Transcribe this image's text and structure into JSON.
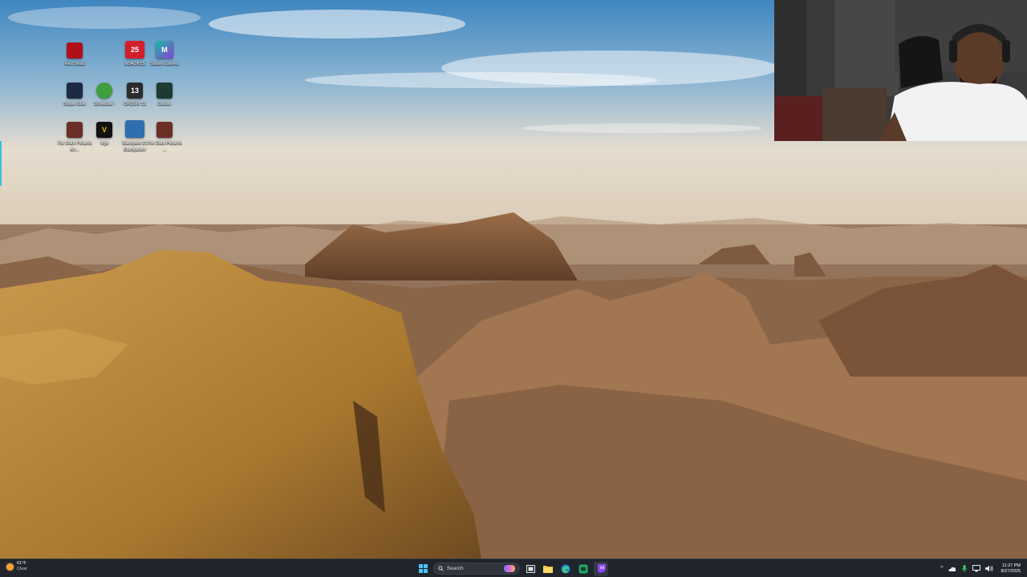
{
  "desktop": {
    "icons": [
      {
        "label": "Red Dead",
        "color": "#b0101a",
        "glyph": "",
        "lines": 1
      },
      {
        "label": "NBA 2K25",
        "color": "#d21f2a",
        "glyph": "25",
        "lines": 1
      },
      {
        "label": "Steam Games",
        "color": "#14bfa1",
        "glyph": "M",
        "lines": 1
      },
      {
        "label": "Sniper Elite",
        "color": "#1e2a44",
        "glyph": "",
        "lines": 1
      },
      {
        "label": "Schedule I",
        "color": "#3d9f3d",
        "glyph": "",
        "lines": 1
      },
      {
        "label": "ORDER 13",
        "color": "#2b2b2b",
        "glyph": "13",
        "lines": 1
      },
      {
        "label": "Gruber",
        "color": "#1f3b31",
        "glyph": "",
        "lines": 1
      },
      {
        "label": "The Dark Pictures An...",
        "color": "#6b2f26",
        "glyph": "",
        "lines": 2
      },
      {
        "label": "Vigil",
        "color": "#111111",
        "glyph": "V",
        "lines": 1
      },
      {
        "label": "Blackjack 21 Blackjacker",
        "color": "#2e6fb0",
        "glyph": "",
        "lines": 2
      },
      {
        "label": "The Dark Pictures ...",
        "color": "#6b2f26",
        "glyph": "",
        "lines": 2
      }
    ]
  },
  "taskbar": {
    "weather": {
      "temp": "61°F",
      "condition": "Clear",
      "icon": "sun-icon"
    },
    "search": {
      "placeholder": "Search"
    },
    "apps": [
      {
        "name": "start-button",
        "icon": "windows-logo-icon"
      },
      {
        "name": "task-view-button",
        "icon": "task-view-icon"
      },
      {
        "name": "file-explorer-button",
        "icon": "folder-icon"
      },
      {
        "name": "edge-button",
        "icon": "edge-icon"
      },
      {
        "name": "xbox-button",
        "icon": "xbox-icon"
      },
      {
        "name": "twitch-button",
        "icon": "twitch-icon"
      }
    ],
    "tray": {
      "overflow": "^",
      "time": "11:27 PM",
      "date": "8/27/2025"
    }
  },
  "colors": {
    "taskbar_bg": "#20242b",
    "accent": "#4cc2ff"
  }
}
